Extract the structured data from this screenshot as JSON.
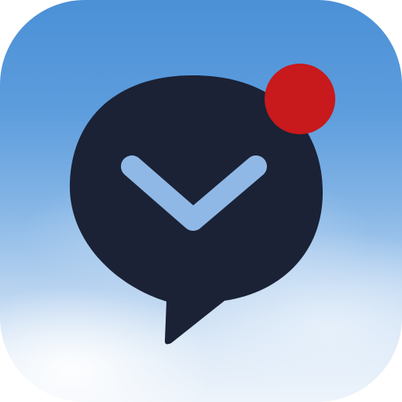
{
  "app_icon": {
    "icon": "chat-bubble-with-chevron",
    "badge": "notification-dot",
    "colors": {
      "background_top": "#4b90d6",
      "background_bottom": "#eef4fb",
      "bubble": "#1b2235",
      "chevron": "#8fb8e6",
      "badge": "#c8191c"
    }
  }
}
